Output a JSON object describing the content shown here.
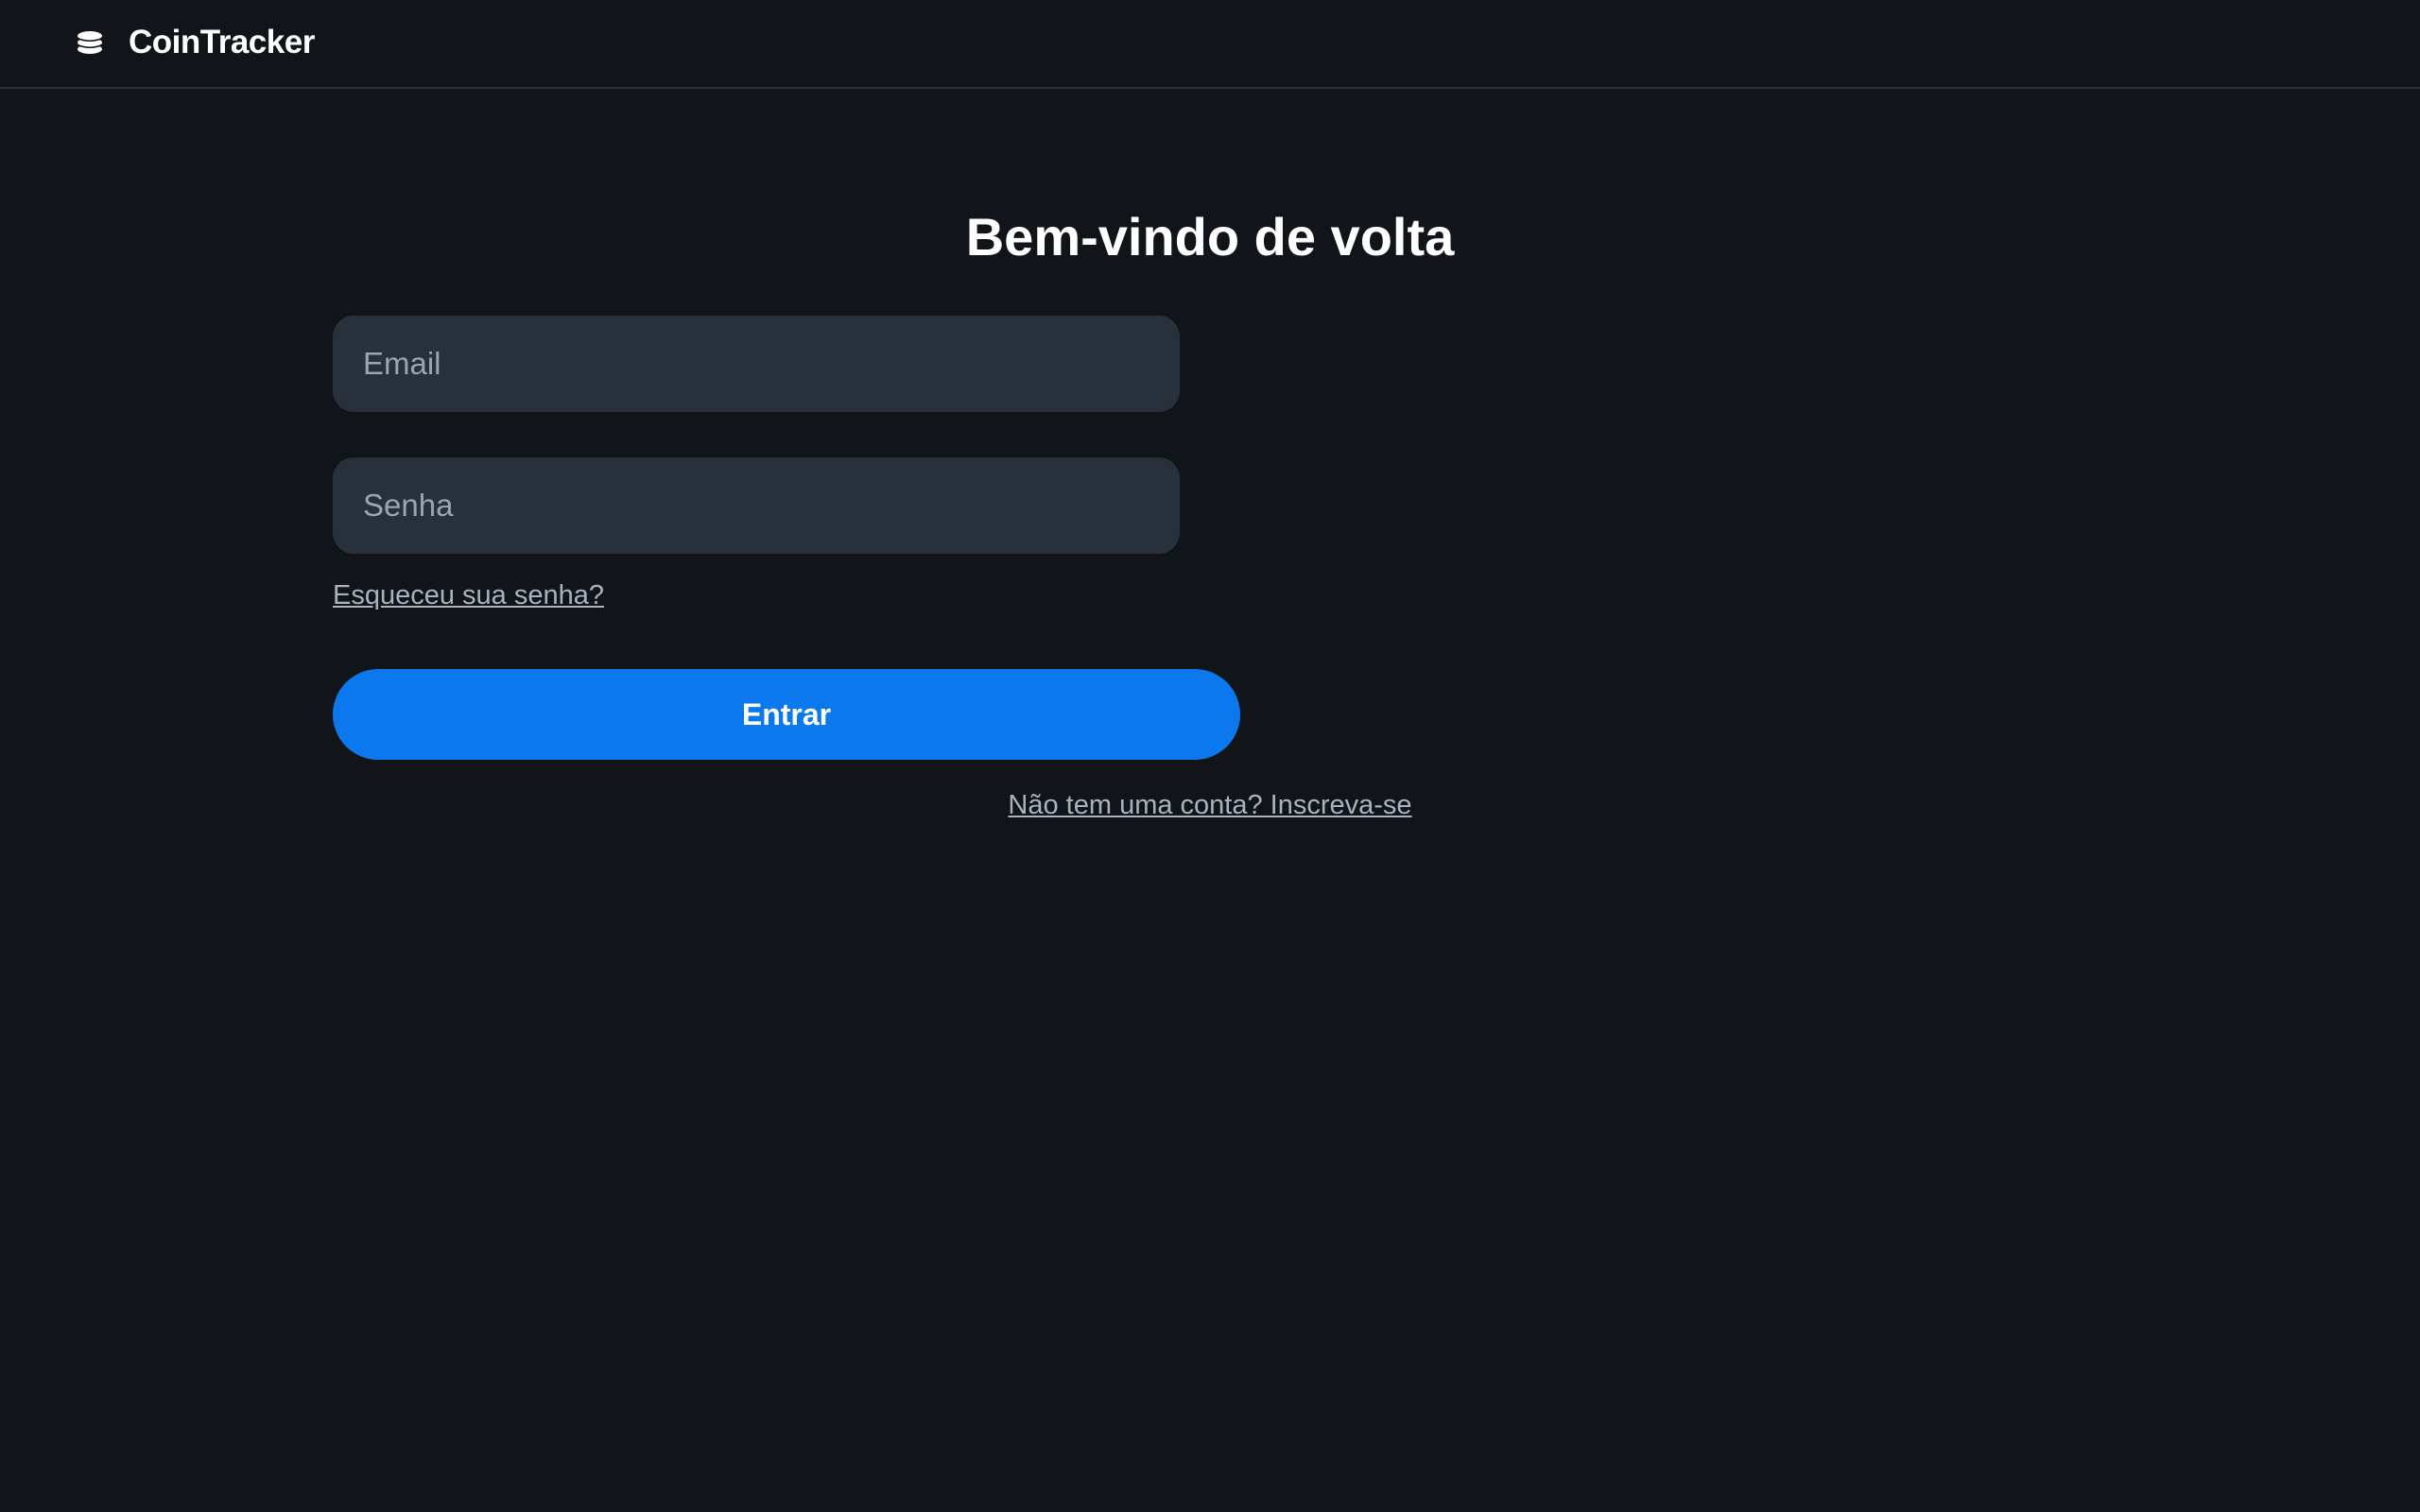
{
  "header": {
    "brand_name": "CoinTracker",
    "logo_icon": "coin-stack-icon"
  },
  "login": {
    "title": "Bem-vindo de volta",
    "email_placeholder": "Email",
    "email_value": "",
    "password_placeholder": "Senha",
    "password_value": "",
    "forgot_password_label": "Esqueceu sua senha?",
    "submit_label": "Entrar",
    "signup_label": "Não tem uma conta? Inscreva-se"
  },
  "colors": {
    "background": "#111418",
    "field_background": "#28313b",
    "accent": "#0b78ee",
    "link": "#a9b3bf"
  }
}
